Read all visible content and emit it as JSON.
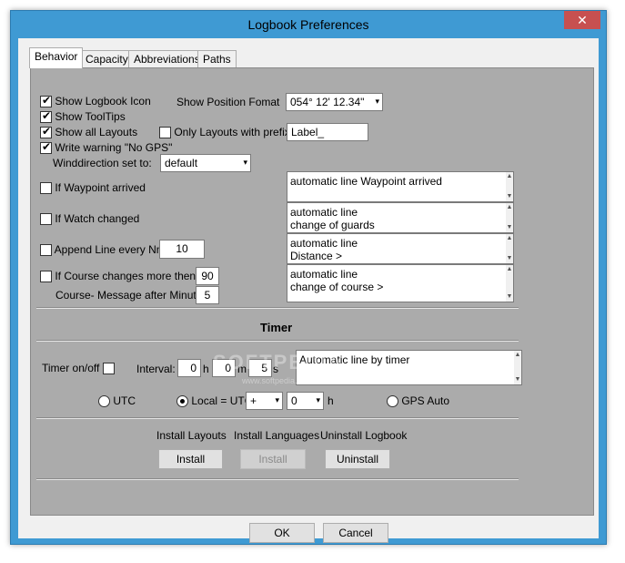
{
  "window": {
    "title": "Logbook Preferences",
    "close_glyph": "✕"
  },
  "tabs": [
    {
      "label": "Behavior",
      "active": true
    },
    {
      "label": "Capacity",
      "active": false
    },
    {
      "label": "Abbreviations",
      "active": false
    },
    {
      "label": "Paths",
      "active": false
    }
  ],
  "behavior": {
    "show_logbook_icon": {
      "label": "Show Logbook Icon",
      "checked": true
    },
    "show_tooltips": {
      "label": "Show ToolTips",
      "checked": true
    },
    "show_all_layouts": {
      "label": "Show all Layouts",
      "checked": true
    },
    "write_warning": {
      "label": "Write warning \"No GPS\"",
      "checked": true
    },
    "only_layouts_prefix": {
      "label": "Only Layouts with prefix:",
      "checked": false,
      "value": "Label_"
    },
    "position_format": {
      "label": "Show Position Fomat",
      "value": "054° 12' 12.34\""
    },
    "winddirection": {
      "label": "Winddirection set to:",
      "value": "default"
    },
    "waypoint": {
      "label": "If Waypoint arrived",
      "checked": false,
      "memo": [
        "automatic line Waypoint arrived"
      ]
    },
    "watch": {
      "label": "If Watch changed",
      "checked": false,
      "memo": [
        "automatic line",
        "change of guards"
      ]
    },
    "append": {
      "label": "Append Line every Nm",
      "checked": false,
      "value": "10",
      "memo": [
        "automatic line",
        "Distance >"
      ]
    },
    "course": {
      "label": "If Course changes more then",
      "checked": false,
      "value": "90",
      "memo": [
        "automatic line",
        "change of course >"
      ]
    },
    "course_message": {
      "label": "Course- Message after Minutes",
      "value": "5"
    }
  },
  "timer": {
    "heading": "Timer",
    "onoff_label": "Timer on/off",
    "onoff_checked": false,
    "interval_label": "Interval:",
    "hours": "0",
    "hours_unit": "h",
    "minutes": "0",
    "minutes_unit": "m",
    "seconds": "5",
    "seconds_unit": "s",
    "memo": "Automatic line by timer",
    "utc_label": "UTC",
    "local_label": "Local = UTC",
    "offset_sign": "+",
    "offset_value": "0",
    "offset_unit": "h",
    "gps_auto_label": "GPS Auto",
    "selected": "local"
  },
  "install": {
    "layouts_label": "Install Layouts",
    "languages_label": "Install Languages",
    "uninstall_label": "Uninstall Logbook",
    "install_btn": "Install",
    "install_lang_btn": "Install",
    "uninstall_btn": "Uninstall"
  },
  "dialog": {
    "ok": "OK",
    "cancel": "Cancel"
  },
  "watermark": {
    "big": "SOFTPEDIA",
    "small": "www.softpedia.com"
  },
  "icons": {
    "arrow": "▾",
    "up": "▲",
    "down": "▼"
  },
  "colors": {
    "titlebar": "#3f9ad3",
    "close": "#c75050",
    "panel": "#ababab"
  }
}
